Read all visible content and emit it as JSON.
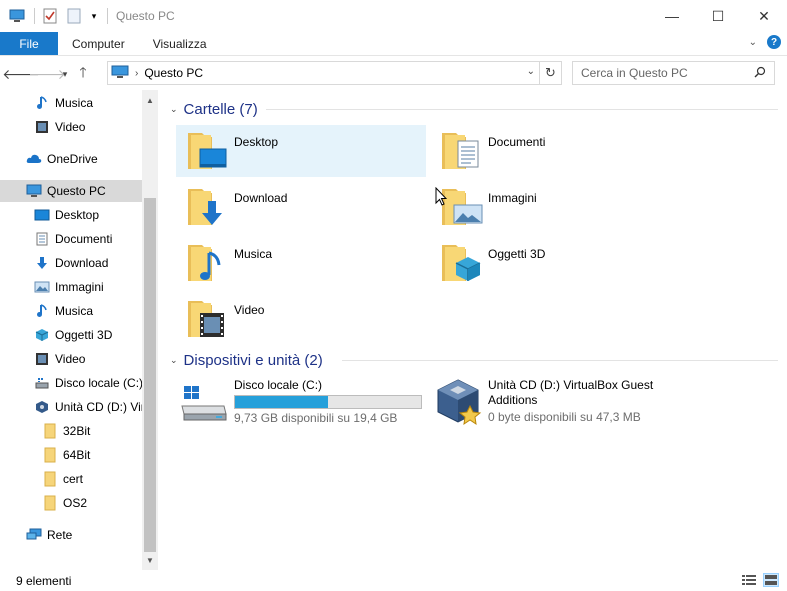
{
  "window": {
    "title": "Questo PC"
  },
  "ribbon": {
    "tabs": [
      "File",
      "Computer",
      "Visualizza"
    ]
  },
  "address": {
    "path": "Questo PC",
    "search_placeholder": "Cerca in Questo PC"
  },
  "nav": {
    "items": [
      {
        "label": "Musica",
        "icon": "music-icon"
      },
      {
        "label": "Video",
        "icon": "video-icon"
      },
      {
        "label": "OneDrive",
        "icon": "cloud-icon"
      },
      {
        "label": "Questo PC",
        "icon": "computer-icon",
        "selected": true
      },
      {
        "label": "Desktop",
        "icon": "desktop-icon"
      },
      {
        "label": "Documenti",
        "icon": "documents-icon"
      },
      {
        "label": "Download",
        "icon": "download-icon"
      },
      {
        "label": "Immagini",
        "icon": "pictures-icon"
      },
      {
        "label": "Musica",
        "icon": "music-icon"
      },
      {
        "label": "Oggetti 3D",
        "icon": "cube-icon"
      },
      {
        "label": "Video",
        "icon": "video-icon"
      },
      {
        "label": "Disco locale (C:)",
        "icon": "drive-icon"
      },
      {
        "label": "Unità CD (D:) VirtualBox Guest Additions",
        "icon": "cd-icon"
      },
      {
        "label": "32Bit",
        "icon": "folder-icon"
      },
      {
        "label": "64Bit",
        "icon": "folder-icon"
      },
      {
        "label": "cert",
        "icon": "folder-icon"
      },
      {
        "label": "OS2",
        "icon": "folder-icon"
      },
      {
        "label": "Rete",
        "icon": "network-icon"
      }
    ]
  },
  "content": {
    "folders_group": "Cartelle (7)",
    "folders": [
      {
        "label": "Desktop",
        "icon": "desktop-folder-icon",
        "selected": true
      },
      {
        "label": "Documenti",
        "icon": "documents-folder-icon"
      },
      {
        "label": "Download",
        "icon": "download-folder-icon"
      },
      {
        "label": "Immagini",
        "icon": "pictures-folder-icon"
      },
      {
        "label": "Musica",
        "icon": "music-folder-icon"
      },
      {
        "label": "Oggetti 3D",
        "icon": "3d-objects-folder-icon"
      },
      {
        "label": "Video",
        "icon": "video-folder-icon"
      }
    ],
    "devices_group": "Dispositivi e unità (2)",
    "drives": [
      {
        "name": "Disco locale (C:)",
        "free": "9,73 GB disponibili su 19,4 GB",
        "used_fraction": 0.5,
        "icon": "windows-drive-icon"
      },
      {
        "name": "Unità CD (D:) VirtualBox Guest Additions",
        "free": "0 byte disponibili su 47,3 MB",
        "icon": "virtualbox-cd-icon"
      }
    ]
  },
  "status": {
    "items_count": "9 elementi"
  },
  "colors": {
    "accent": "#1979ca",
    "group_text": "#1e3287",
    "selection": "#e5f3fb",
    "progress": "#26a0da"
  }
}
